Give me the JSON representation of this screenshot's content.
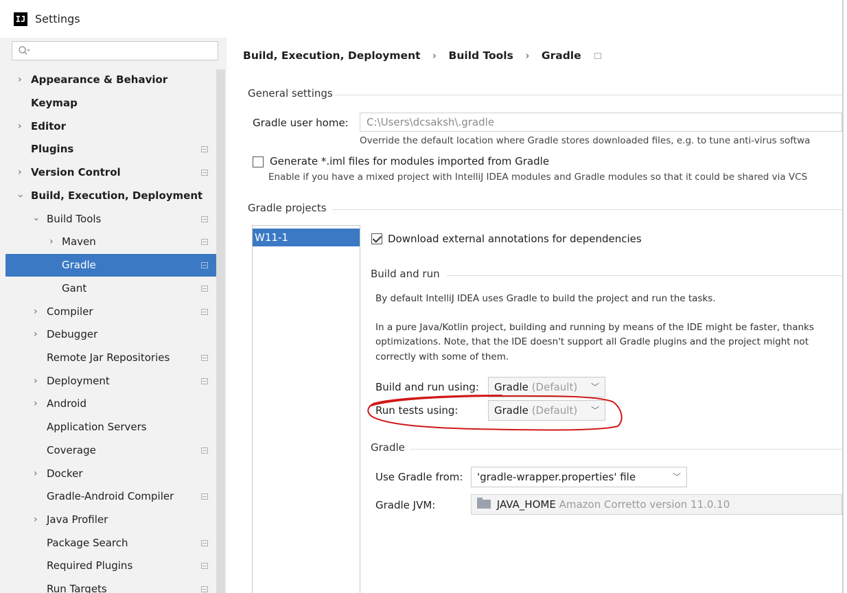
{
  "window": {
    "title": "Settings",
    "logo_text": "IJ"
  },
  "search": {
    "placeholder": ""
  },
  "sidebar": {
    "items": [
      {
        "label": "Appearance & Behavior"
      },
      {
        "label": "Keymap"
      },
      {
        "label": "Editor"
      },
      {
        "label": "Plugins"
      },
      {
        "label": "Version Control"
      },
      {
        "label": "Build, Execution, Deployment"
      },
      {
        "label": "Build Tools"
      },
      {
        "label": "Maven"
      },
      {
        "label": "Gradle"
      },
      {
        "label": "Gant"
      },
      {
        "label": "Compiler"
      },
      {
        "label": "Debugger"
      },
      {
        "label": "Remote Jar Repositories"
      },
      {
        "label": "Deployment"
      },
      {
        "label": "Android"
      },
      {
        "label": "Application Servers"
      },
      {
        "label": "Coverage"
      },
      {
        "label": "Docker"
      },
      {
        "label": "Gradle-Android Compiler"
      },
      {
        "label": "Java Profiler"
      },
      {
        "label": "Package Search"
      },
      {
        "label": "Required Plugins"
      },
      {
        "label": "Run Targets"
      }
    ]
  },
  "breadcrumb": {
    "parts": [
      "Build, Execution, Deployment",
      "Build Tools",
      "Gradle"
    ],
    "separator": "›"
  },
  "general": {
    "title": "General settings",
    "user_home_label": "Gradle user home:",
    "user_home_placeholder": "C:\\Users\\dcsaksh\\.gradle",
    "user_home_hint": "Override the default location where Gradle stores downloaded files, e.g. to tune anti-virus softwa",
    "iml_label": "Generate *.iml files for modules imported from Gradle",
    "iml_hint": "Enable if you have a mixed project with IntelliJ IDEA modules and Gradle modules so that it could be shared via VCS",
    "iml_checked": false
  },
  "projects": {
    "title": "Gradle projects",
    "list": [
      "W11-1"
    ],
    "download_annotations_label": "Download external annotations for dependencies",
    "download_annotations_checked": true
  },
  "build_run": {
    "title": "Build and run",
    "para1": "By default IntelliJ IDEA uses Gradle to build the project and run the tasks.",
    "para2_line1": "In a pure Java/Kotlin project, building and running by means of the IDE might be faster, thanks",
    "para2_line2": "optimizations. Note, that the IDE doesn't support all Gradle plugins and the project might not",
    "para2_line3": "correctly with some of them.",
    "build_using_label": "Build and run using:",
    "build_using_value": "Gradle",
    "build_using_suffix": "(Default)",
    "tests_using_label": "Run tests using:",
    "tests_using_value": "Gradle",
    "tests_using_suffix": "(Default)"
  },
  "gradle": {
    "title": "Gradle",
    "use_from_label": "Use Gradle from:",
    "use_from_value": "'gradle-wrapper.properties' file",
    "jvm_label": "Gradle JVM:",
    "jvm_value": "JAVA_HOME",
    "jvm_detail": "Amazon Corretto version 11.0.10"
  },
  "colors": {
    "selection": "#3b79c4",
    "annotation": "#d01818"
  }
}
